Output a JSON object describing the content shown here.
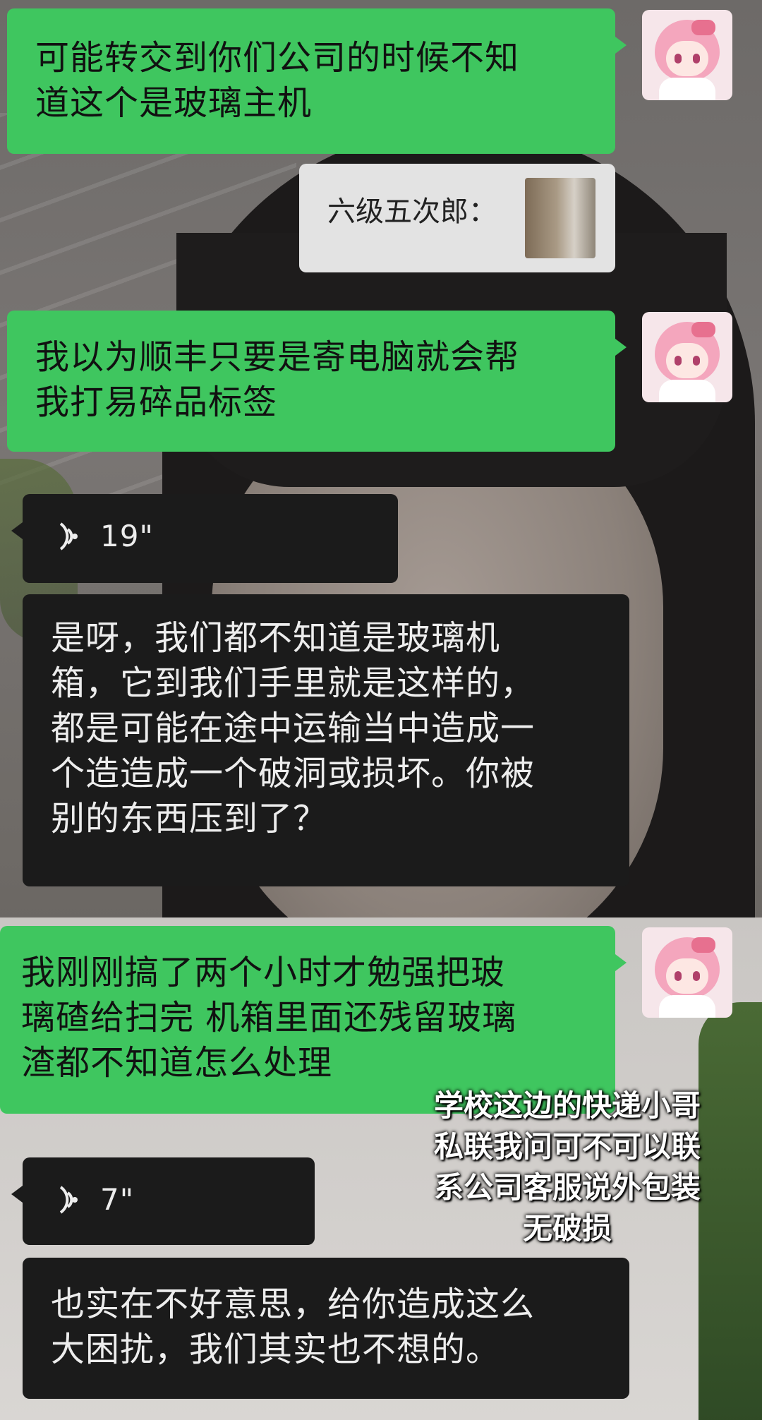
{
  "messages": [
    {
      "id": "m1",
      "side": "out",
      "text": "可能转交到你们公司的时候不知\n道这个是玻璃主机"
    },
    {
      "id": "m2",
      "side": "quote",
      "text": "六级五次郎："
    },
    {
      "id": "m3",
      "side": "out",
      "text": "我以为顺丰只要是寄电脑就会帮\n我打易碎品标签"
    },
    {
      "id": "m4",
      "side": "voice",
      "duration": "19\""
    },
    {
      "id": "m5",
      "side": "in",
      "text": "是呀，我们都不知道是玻璃机\n箱，它到我们手里就是这样的，\n都是可能在途中运输当中造成一\n个造造成一个破洞或损坏。你被\n别的东西压到了？"
    },
    {
      "id": "m6",
      "side": "out",
      "text": "我刚刚搞了两个小时才勉强把玻\n璃碴给扫完 机箱里面还残留玻璃\n渣都不知道怎么处理"
    },
    {
      "id": "m7",
      "side": "voice",
      "duration": "7\""
    },
    {
      "id": "m8",
      "side": "in",
      "text": "也实在不好意思，给你造成这么\n大困扰，我们其实也不想的。"
    }
  ],
  "overlay": {
    "text": "学校这边的快递小哥\n私联我问可不可以联\n系公司客服说外包装\n无破损"
  },
  "colors": {
    "outgoing_bubble": "#3fc65f",
    "incoming_bubble": "#1b1b1b",
    "quote_bubble": "#e3e3e3"
  },
  "icons": {
    "avatar": "pink-hair-anime-girl-avatar",
    "voice": "voice-wave-icon"
  }
}
